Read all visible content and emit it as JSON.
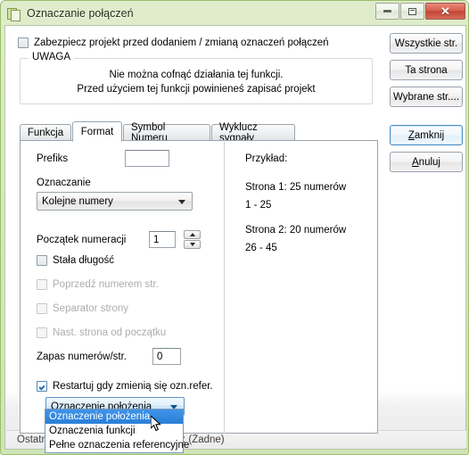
{
  "window": {
    "title": "Oznaczanie połączeń",
    "icon": "window-document-icon",
    "caption_buttons": {
      "minimize": "minimize-icon",
      "maximize": "restore-icon",
      "close": "✕"
    },
    "frame_color": "#cfe4b6",
    "accent_color": "#2a7fd6"
  },
  "protect": {
    "label": "Zabezpiecz projekt przed dodaniem / zmianą oznaczeń połączeń",
    "checked": false
  },
  "warning": {
    "legend": "UWAGA",
    "line1": "Nie można cofnąć działania tej funkcji.",
    "line2": "Przed użyciem tej funkcji powinieneś zapisać projekt"
  },
  "tabs": [
    {
      "label": "Funkcja",
      "active": false
    },
    {
      "label": "Format",
      "active": true
    },
    {
      "label": "Symbol Numeru",
      "active": false
    },
    {
      "label": "Wyklucz sygnały",
      "active": false
    }
  ],
  "form": {
    "prefix_label": "Prefiks",
    "prefix_value": "",
    "marking_label": "Oznaczanie",
    "marking_value": "Kolejne numery",
    "start_label": "Początek numeracji",
    "start_value": "1",
    "fixed_length_label": "Stała długość",
    "fixed_length_checked": false,
    "prefix_page_label": "Poprzedź numerem str.",
    "prefix_page_checked": false,
    "prefix_page_enabled": false,
    "page_separator_label": "Separator strony",
    "page_separator_checked": false,
    "page_separator_enabled": false,
    "next_page_label": "Nast. strona od początku",
    "next_page_checked": false,
    "next_page_enabled": false,
    "reserve_label": "Zapas numerów/str.",
    "reserve_value": "0",
    "restart_label": "Restartuj gdy zmienią się ozn.refer.",
    "restart_checked": true,
    "restart_combo_value": "Oznaczenie położenia",
    "restart_combo_options": [
      {
        "label": "Oznaczenie położenia",
        "selected": true
      },
      {
        "label": "Oznaczenia funkcji",
        "selected": false
      },
      {
        "label": "Pełne oznaczenia referencyjne",
        "selected": false
      }
    ]
  },
  "example": {
    "title": "Przykład:",
    "line1": "Strona 1: 25 numerów",
    "line2": "1 - 25",
    "line3": "Strona 2: 20 numerów",
    "line4": "26 - 45"
  },
  "buttons": {
    "all_pages": "Wszystkie str.",
    "this_page": "Ta strona",
    "selected_pages": "Wybrane str....",
    "close_pre": "",
    "close_accel": "Z",
    "close_rest": "amknij",
    "cancel_pre": "",
    "cancel_accel": "A",
    "cancel_rest": "nuluj"
  },
  "statusbar": {
    "text": "Ostatni użyty numer żyły w projekcie: (Żadne)"
  }
}
